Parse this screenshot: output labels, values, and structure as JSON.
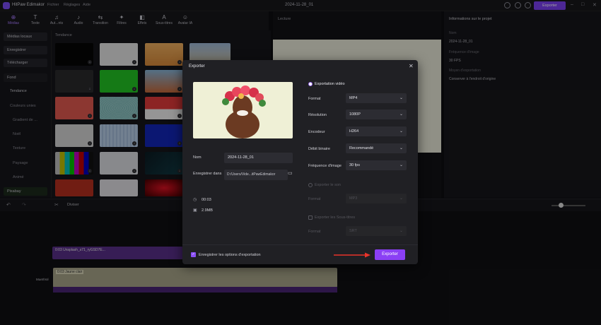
{
  "titlebar": {
    "app_name": "HitPaw Edimakor",
    "menu": [
      "Fichier",
      "Réglages",
      "Aide"
    ],
    "project_title": "2024-11-28_01",
    "export_label": "Exporter"
  },
  "toolbar": {
    "tabs": [
      {
        "label": "Médias",
        "glyph": "⊕"
      },
      {
        "label": "Texte",
        "glyph": "T"
      },
      {
        "label": "Aut...nts",
        "glyph": "♫"
      },
      {
        "label": "Audio",
        "glyph": "♪"
      },
      {
        "label": "Transition",
        "glyph": "⇆"
      },
      {
        "label": "Filtres",
        "glyph": "✦"
      },
      {
        "label": "Effets",
        "glyph": "◧"
      },
      {
        "label": "Sous-titres",
        "glyph": "A"
      },
      {
        "label": "Avatar IA",
        "glyph": "☺"
      }
    ]
  },
  "leftnav": {
    "items": [
      "Médias locaux",
      "Enregistrer",
      "Télécharger"
    ],
    "section": "Fond",
    "sub": [
      "Tendance",
      "Couleurs unies",
      "Gradient de ...",
      "Noël",
      "Texture",
      "Paysage",
      "Animé"
    ],
    "bottom": "Pixabay"
  },
  "media": {
    "header": "Tendance"
  },
  "preview": {
    "title": "Lecture"
  },
  "inspector": {
    "title": "Informations sur le projet",
    "name_label": "Nom",
    "name_value": "2024-11-28_01",
    "fps_label": "Fréquence d'image",
    "fps_value": "30 FPS",
    "save_label": "Moyen d'exportation",
    "save_value": "Conserver à l'endroit d'origine"
  },
  "timeline": {
    "split_label": "Diviser",
    "clip1": "0:03 Unsplash_s71_ryGSD7E...",
    "clip2": "0:03 Jaune clair",
    "track_label": "Muet/Vol"
  },
  "dialog": {
    "title": "Exporter",
    "name_label": "Nom",
    "name_value": "2024-11-28_01",
    "save_label": "Enregistrer dans",
    "save_path": "D:/Users/Vide...itPawEdimakor",
    "duration": "00:03",
    "size": "2.9MB",
    "video_section": "Exportation vidéo",
    "format_label": "Format",
    "format_value": "MP4",
    "resolution_label": "Résolution",
    "resolution_value": "1080P",
    "encoder_label": "Encodeur",
    "encoder_value": "H264",
    "bitrate_label": "Débit binaire",
    "bitrate_value": "Recommandé",
    "framerate_label": "Fréquence d'image",
    "framerate_value": "30  fps",
    "audio_section": "Exporter le son",
    "audio_format_label": "Format",
    "audio_format_value": "MP3",
    "subs_section": "Exporter les Sous-titres",
    "subs_format_label": "Format",
    "subs_format_value": "SRT",
    "save_options": "Enregistrer les options d'exportation",
    "export_button": "Exporter"
  },
  "colors": {
    "accent": "#8b3ff5",
    "arrow": "#e8332a"
  }
}
